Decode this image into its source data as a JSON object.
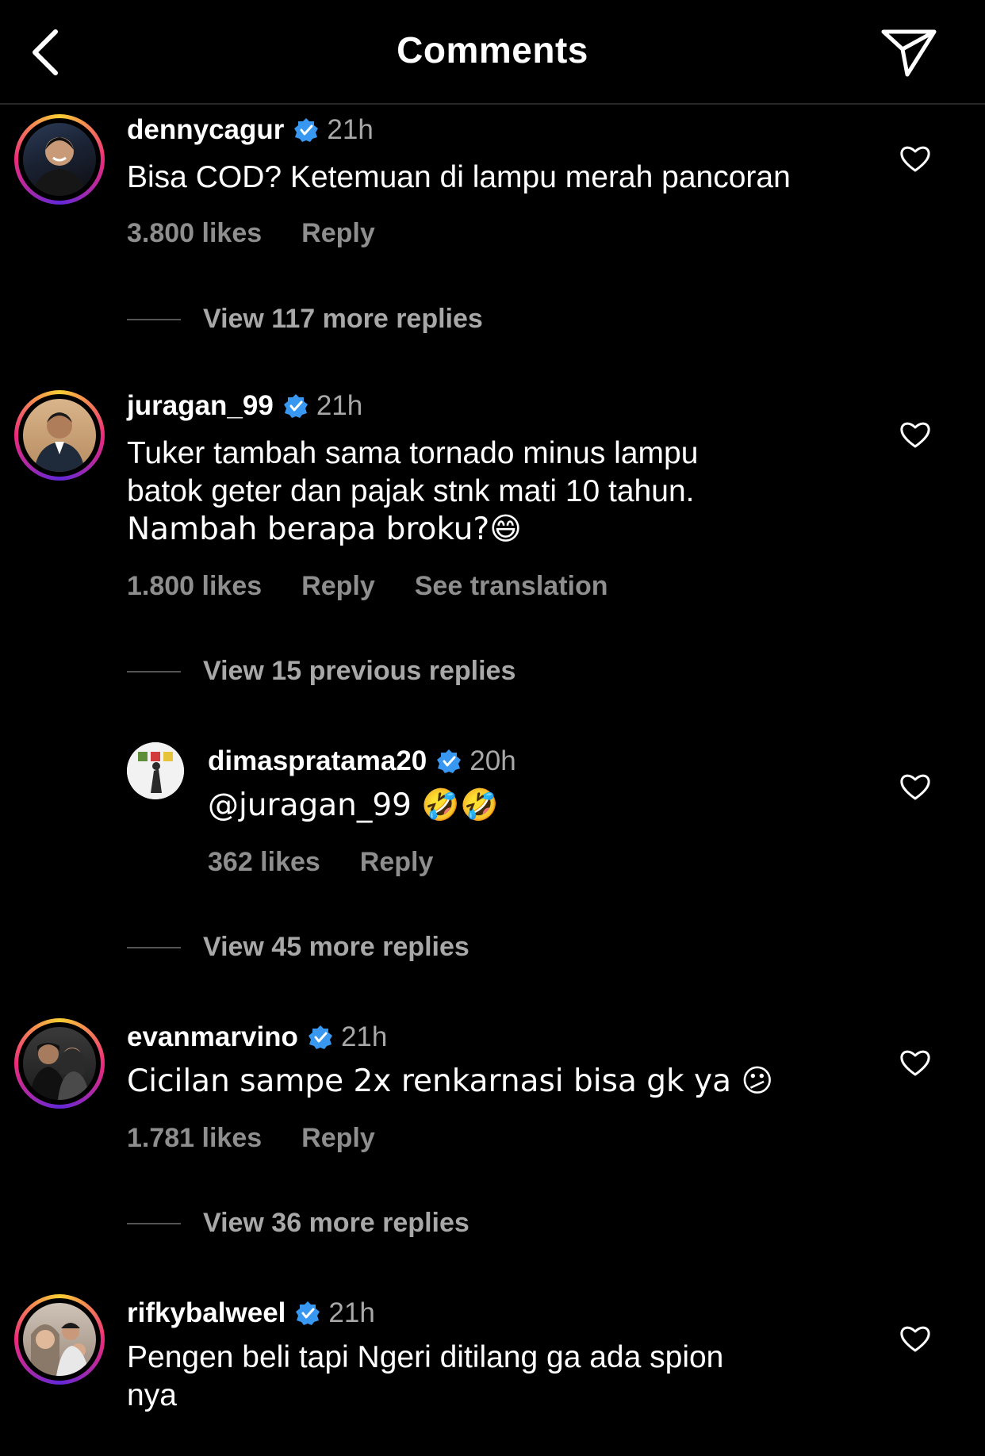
{
  "header": {
    "title": "Comments"
  },
  "colors": {
    "background": "#000000",
    "verified": "#3897f0",
    "muted": "#a8a8a8"
  },
  "comments": [
    {
      "username": "dennycagur",
      "time": "21h",
      "text": "Bisa COD? Ketemuan di lampu merah pancoran",
      "likes": "3.800 likes",
      "reply": "Reply",
      "replies_link": "View 117 more replies"
    },
    {
      "username": "juragan_99",
      "time": "21h",
      "text_lines": [
        "Tuker tambah sama tornado minus lampu",
        "batok geter dan pajak stnk mati 10 tahun.",
        "Nambah berapa broku?😄"
      ],
      "likes": "1.800 likes",
      "reply": "Reply",
      "translation": "See translation",
      "previous_replies_link": "View 15 previous replies",
      "reply_item": {
        "username": "dimaspratama20",
        "time": "20h",
        "text": "@juragan_99 🤣🤣",
        "likes": "362 likes",
        "reply": "Reply"
      },
      "replies_link": "View 45 more replies"
    },
    {
      "username": "evanmarvino",
      "time": "21h",
      "text": "Cicilan sampe 2x renkarnasi bisa gk ya 😕",
      "likes": "1.781 likes",
      "reply": "Reply",
      "replies_link": "View 36 more replies"
    },
    {
      "username": "rifkybalweel",
      "time": "21h",
      "text_lines": [
        "Pengen beli tapi Ngeri ditilang ga ada spion",
        "nya"
      ]
    }
  ]
}
